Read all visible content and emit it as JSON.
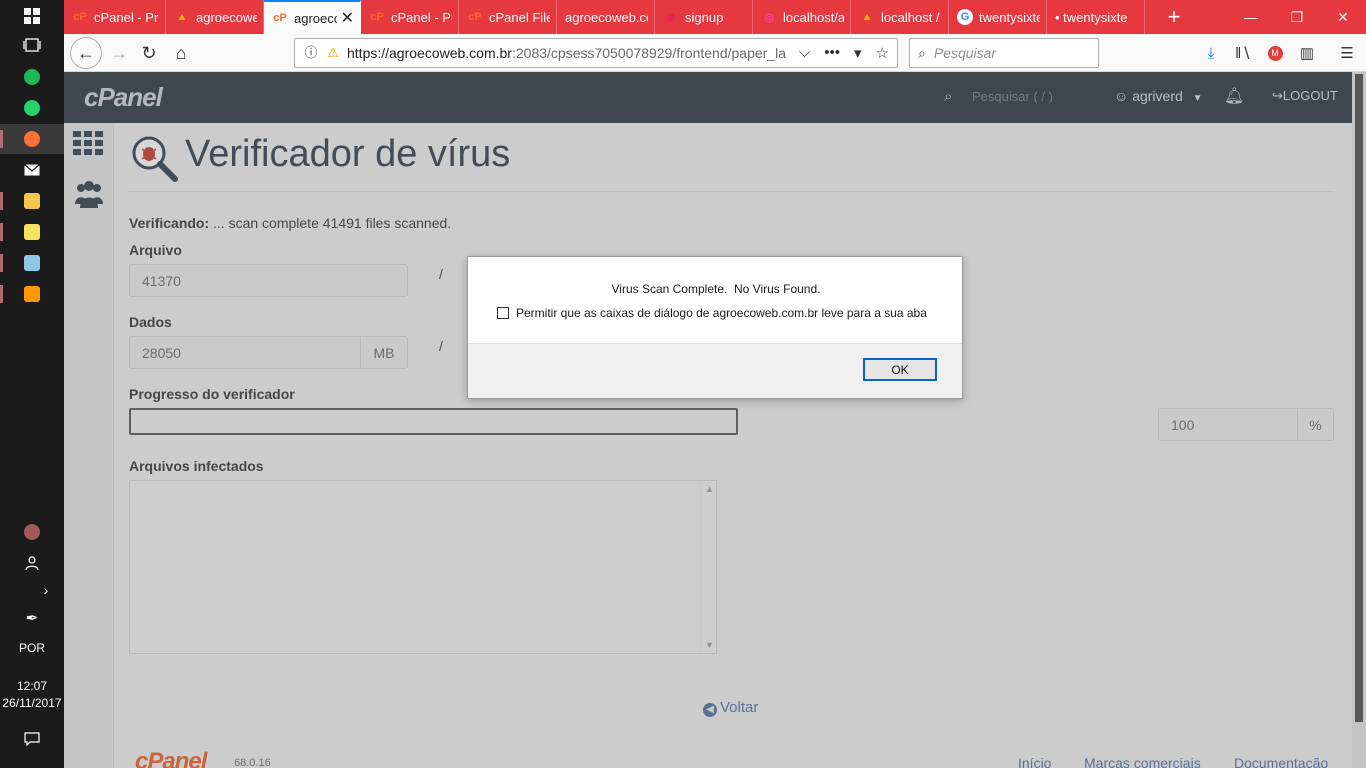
{
  "taskbar": {
    "language": "POR",
    "time": "12:07",
    "date": "26/11/2017"
  },
  "browser": {
    "tabs": [
      {
        "label": "cPanel - Pr",
        "favicon": "cpanel-icon"
      },
      {
        "label": "agroecowe",
        "favicon": "warning-icon"
      },
      {
        "label": "agroecc",
        "favicon": "cpanel-icon",
        "active": true
      },
      {
        "label": "cPanel - Pr",
        "favicon": "cpanel-icon"
      },
      {
        "label": "cPanel File",
        "favicon": "cpanel-icon"
      },
      {
        "label": "agroecoweb.co",
        "favicon": ""
      },
      {
        "label": "signup",
        "favicon": "signup-icon"
      },
      {
        "label": "localhost/a",
        "favicon": "instagram-icon"
      },
      {
        "label": "localhost /",
        "favicon": "warning-icon"
      },
      {
        "label": "twentysixte",
        "favicon": "google-icon"
      },
      {
        "label": "• twentysixte",
        "favicon": ""
      }
    ],
    "url_host": "https://agroecoweb.com.br",
    "url_rest": ":2083/cpsess7050078929/frontend/paper_la",
    "search_placeholder": "Pesquisar"
  },
  "cpanel": {
    "logo": "cPanel",
    "search_placeholder": "Pesquisar ( / )",
    "user": "agriverd",
    "logout": "LOGOUT"
  },
  "page": {
    "title": "Verificador de vírus",
    "status_label": "Verificando:",
    "status_text": " ... scan complete 41491 files scanned.",
    "file_label": "Arquivo",
    "file_value": "41370",
    "data_label": "Dados",
    "data_value": "28050",
    "data_unit": "MB",
    "progress_label": "Progresso do verificador",
    "progress_value": "100",
    "progress_unit": "%",
    "infected_label": "Arquivos infectados",
    "back_link": "Voltar"
  },
  "footer": {
    "logo": "cPanel",
    "version": "68.0.16",
    "links": [
      "Início",
      "Marcas comerciais",
      "Documentação"
    ]
  },
  "dialog": {
    "message": "Virus Scan Complete.  No Virus Found.",
    "checkbox_label": "Permitir que as caixas de diálogo de agroecoweb.com.br leve para a sua aba",
    "ok_label": "OK"
  },
  "colors": {
    "tab_bar": "#e5383f",
    "cpanel_header": "#283341",
    "link": "#4b6ea0",
    "accent_focus": "#0a64c8"
  }
}
